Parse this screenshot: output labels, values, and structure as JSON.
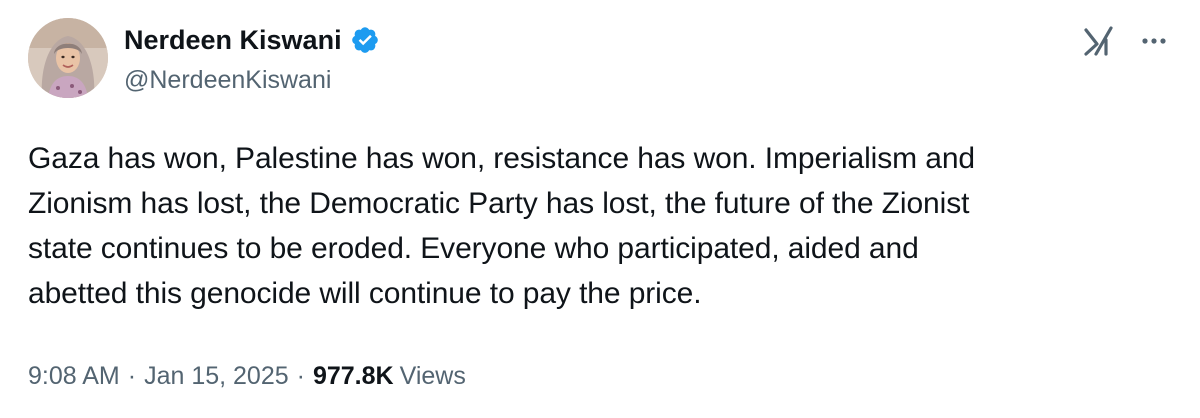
{
  "author": {
    "display_name": "Nerdeen Kiswani",
    "handle": "@NerdeenKiswani",
    "verified": true,
    "avatar_icon": "profile-photo"
  },
  "actions": {
    "grok_icon": "grok-icon",
    "more_icon": "more-icon"
  },
  "tweet": {
    "text_lines": [
      "Gaza has won, Palestine has won, resistance has won. Imperialism and",
      "Zionism has lost, the Democratic Party has lost, the future of the Zionist",
      "state continues to be eroded. Everyone who participated, aided and",
      "abetted this genocide will continue to pay the price."
    ]
  },
  "meta": {
    "time": "9:08 AM",
    "separator": "·",
    "date": "Jan 15, 2025",
    "views_count": "977.8K",
    "views_label": "Views"
  },
  "colors": {
    "text_primary": "#0f1419",
    "text_secondary": "#536471",
    "verified_blue": "#1d9bf0",
    "background": "#ffffff"
  }
}
